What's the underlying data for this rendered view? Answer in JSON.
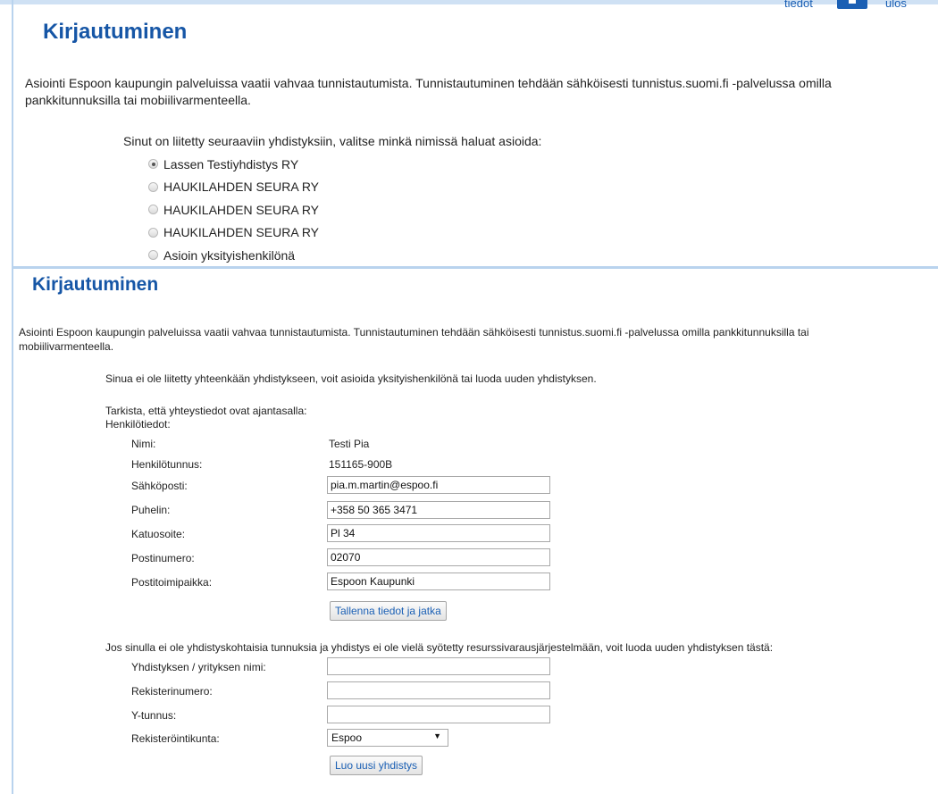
{
  "topnav": {
    "tiedot_label": "tiedot",
    "ulos_label": "ulos"
  },
  "panel1": {
    "title": "Kirjautuminen",
    "intro": "Asiointi Espoon kaupungin palveluissa vaatii vahvaa tunnistautumista. Tunnistautuminen tehdään sähköisesti tunnistus.suomi.fi -palvelussa omilla pankkitunnuksilla tai mobiilivarmenteella.",
    "prompt": "Sinut on liitetty seuraaviin yhdistyksiin, valitse minkä nimissä haluat asioida:",
    "options": [
      {
        "label": "Lassen Testiyhdistys RY",
        "checked": true
      },
      {
        "label": "HAUKILAHDEN SEURA RY",
        "checked": false
      },
      {
        "label": "HAUKILAHDEN SEURA RY",
        "checked": false
      },
      {
        "label": "HAUKILAHDEN SEURA RY",
        "checked": false
      },
      {
        "label": "Asioin yksityishenkilönä",
        "checked": false
      }
    ]
  },
  "panel2": {
    "title": "Kirjautuminen",
    "intro": "Asiointi Espoon kaupungin palveluissa vaatii vahvaa tunnistautumista. Tunnistautuminen tehdään sähköisesti tunnistus.suomi.fi -palvelussa omilla pankkitunnuksilla tai mobiilivarmenteella.",
    "not_linked": "Sinua ei ole liitetty yhteenkään yhdistykseen, voit asioida yksityishenkilönä tai luoda uuden yhdistyksen.",
    "check_text": "Tarkista, että yhteystiedot ovat ajantasalla:",
    "henkilotiedot_label": "Henkilötiedot:",
    "person": {
      "nimi_label": "Nimi:",
      "nimi_value": "Testi Pia",
      "hetu_label": "Henkilötunnus:",
      "hetu_value": "151165-900B",
      "email_label": "Sähköposti:",
      "email_value": "pia.m.martin@espoo.fi",
      "phone_label": "Puhelin:",
      "phone_value": "+358 50 365 3471",
      "street_label": "Katuosoite:",
      "street_value": "Pl 34",
      "zip_label": "Postinumero:",
      "zip_value": "02070",
      "city_label": "Postitoimipaikka:",
      "city_value": "Espoon Kaupunki"
    },
    "save_button": "Tallenna tiedot ja jatka",
    "new_assoc_text": "Jos sinulla ei ole yhdistyskohtaisia tunnuksia ja yhdistys ei ole vielä syötetty resurssivarausjärjestelmään, voit luoda uuden yhdistyksen tästä:",
    "assoc": {
      "name_label": "Yhdistyksen / yrityksen nimi:",
      "reg_label": "Rekisterinumero:",
      "ytunnus_label": "Y-tunnus:",
      "municipality_label": "Rekisteröintikunta:",
      "municipality_value": "Espoo"
    },
    "create_button": "Luo uusi yhdistys"
  }
}
